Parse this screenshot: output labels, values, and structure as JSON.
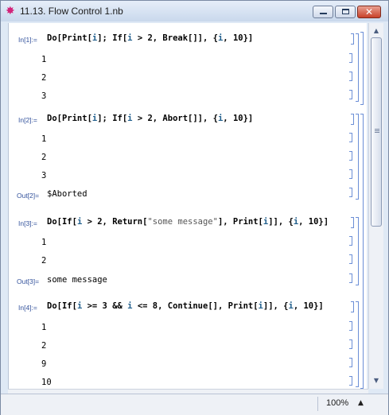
{
  "window": {
    "title": "11.13. Flow Control 1.nb",
    "icon": "mathematica-spikey-icon",
    "controls": {
      "minimize": "minimize",
      "maximize": "maximize",
      "close": "✕"
    }
  },
  "cells": [
    {
      "in_label": "In[1]:=",
      "input": "Do[Print[i]; If[i > 2, Break[]], {i, 10}]",
      "outputs": [
        "1",
        "2",
        "3"
      ]
    },
    {
      "in_label": "In[2]:=",
      "input": "Do[Print[i]; If[i > 2, Abort[]], {i, 10}]",
      "outputs": [
        "1",
        "2",
        "3"
      ],
      "out_label": "Out[2]=",
      "result": "$Aborted"
    },
    {
      "in_label": "In[3]:=",
      "input": "Do[If[i > 2, Return[\"some message\"], Print[i]], {i, 10}]",
      "outputs": [
        "1",
        "2"
      ],
      "out_label": "Out[3]=",
      "result": "some message"
    },
    {
      "in_label": "In[4]:=",
      "input": "Do[If[i >= 3 && i <= 8, Continue[], Print[i]], {i, 10}]",
      "outputs": [
        "1",
        "2",
        "9",
        "10"
      ]
    }
  ],
  "status": {
    "zoom": "100%"
  },
  "colors": {
    "label": "#33529c",
    "bracket": "#6b8ed6",
    "variable": "#1f5e8c"
  }
}
